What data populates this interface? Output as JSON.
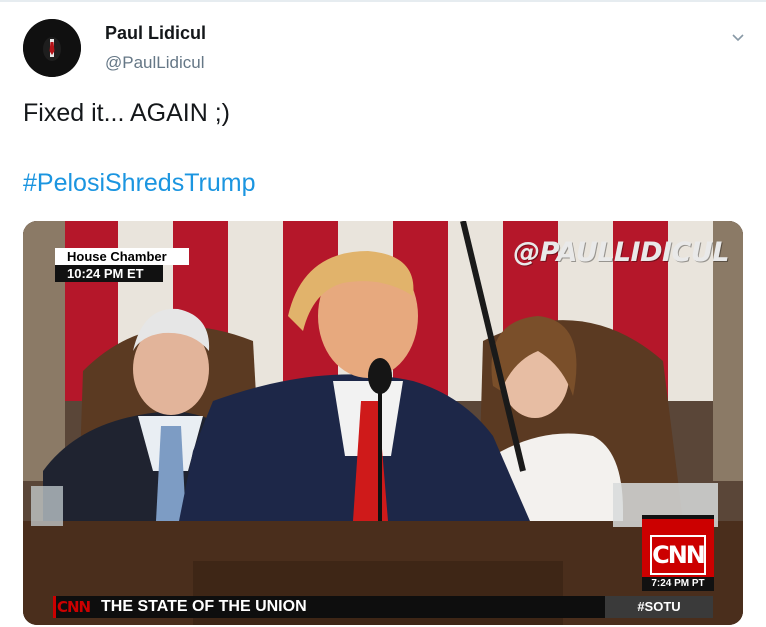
{
  "tweet": {
    "author": {
      "display_name": "Paul Lidicul",
      "handle": "@PaulLidicul"
    },
    "text": "Fixed it... AGAIN ;)",
    "hashtag": "#PelosiShredsTrump",
    "menu_icon": "chevron-down-icon"
  },
  "media": {
    "lower_third": {
      "location": "House Chamber",
      "time": "10:24 PM ET"
    },
    "watermark": "@PAULLIDICUL",
    "network_bug": {
      "logo": "CNN",
      "time": "7:24 PM PT"
    },
    "chyron": {
      "logo": "CNN",
      "headline": "THE STATE OF THE UNION",
      "tag": "#SOTU"
    }
  },
  "colors": {
    "hashtag_link": "#1b95e0",
    "handle_gray": "#657786",
    "cnn_red": "#cc0000"
  }
}
